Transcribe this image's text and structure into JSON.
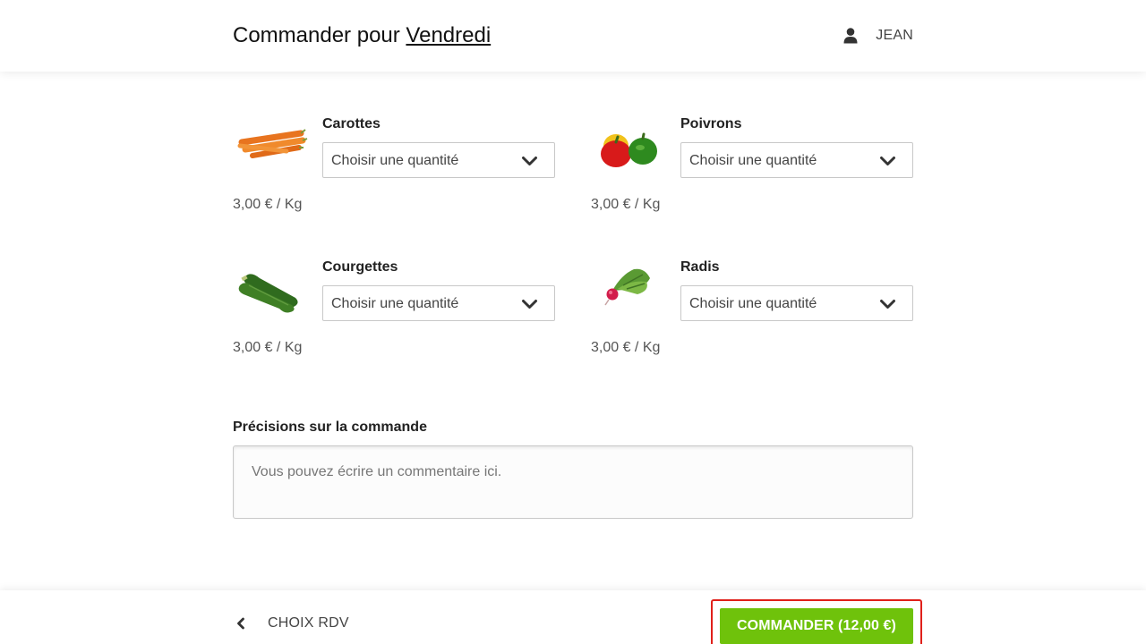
{
  "header": {
    "title_prefix": "Commander pour",
    "title_day": "Vendredi",
    "user_name": "JEAN",
    "user_icon": "user-icon"
  },
  "products": [
    {
      "name": "Carottes",
      "price": "3,00 € / Kg",
      "select_value": "Choisir une quantité",
      "icon": "carrots-image"
    },
    {
      "name": "Poivrons",
      "price": "3,00 € / Kg",
      "select_value": "Choisir une quantité",
      "icon": "peppers-image"
    },
    {
      "name": "Courgettes",
      "price": "3,00 € / Kg",
      "select_value": "Choisir une quantité",
      "icon": "zucchini-image"
    },
    {
      "name": "Radis",
      "price": "3,00 € / Kg",
      "select_value": "Choisir une quantité",
      "icon": "radish-image"
    }
  ],
  "notes": {
    "label": "Précisions sur la commande",
    "placeholder": "Vous pouvez écrire un commentaire ici.",
    "value": ""
  },
  "footer": {
    "back_label": "CHOIX RDV",
    "back_icon": "chevron-left-icon",
    "order_label": "COMMANDER (12,00 €)",
    "order_color": "#6fc20b",
    "highlight_color": "#e0201a"
  }
}
